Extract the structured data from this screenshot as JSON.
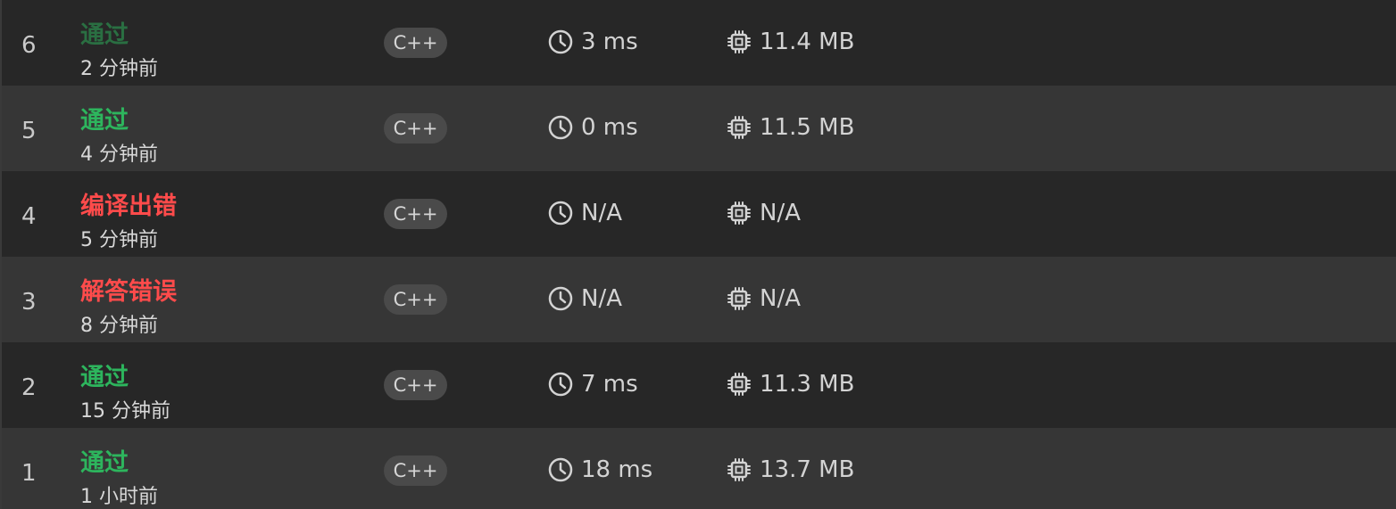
{
  "submissions": [
    {
      "index": "6",
      "status": "通过",
      "status_kind": "pass-dim",
      "time_ago": "2 分钟前",
      "language": "C++",
      "runtime": "3 ms",
      "memory": "11.4 MB"
    },
    {
      "index": "5",
      "status": "通过",
      "status_kind": "pass",
      "time_ago": "4 分钟前",
      "language": "C++",
      "runtime": "0 ms",
      "memory": "11.5 MB"
    },
    {
      "index": "4",
      "status": "编译出错",
      "status_kind": "fail",
      "time_ago": "5 分钟前",
      "language": "C++",
      "runtime": "N/A",
      "memory": "N/A"
    },
    {
      "index": "3",
      "status": "解答错误",
      "status_kind": "fail",
      "time_ago": "8 分钟前",
      "language": "C++",
      "runtime": "N/A",
      "memory": "N/A"
    },
    {
      "index": "2",
      "status": "通过",
      "status_kind": "pass",
      "time_ago": "15 分钟前",
      "language": "C++",
      "runtime": "7 ms",
      "memory": "11.3 MB"
    },
    {
      "index": "1",
      "status": "通过",
      "status_kind": "pass",
      "time_ago": "1 小时前",
      "language": "C++",
      "runtime": "18 ms",
      "memory": "13.7 MB"
    }
  ],
  "colors": {
    "pass": "#2db55d",
    "pass_dim": "#2a6f42",
    "fail": "#ff4b4b",
    "row_dark": "#272727",
    "row_light": "#363636",
    "badge_bg": "#4a4a4a"
  },
  "icons": {
    "runtime": "clock-icon",
    "memory": "chip-icon"
  }
}
